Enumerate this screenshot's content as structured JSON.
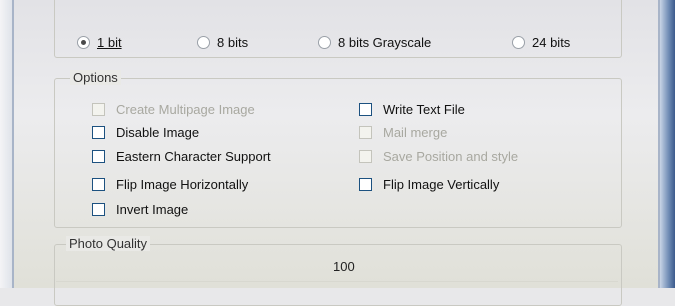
{
  "format": {
    "options": [
      {
        "label": "1 bit",
        "checked": true
      },
      {
        "label": "8 bits",
        "checked": false
      },
      {
        "label": "8 bits Grayscale",
        "checked": false
      },
      {
        "label": "24 bits",
        "checked": false
      }
    ]
  },
  "options": {
    "title": "Options",
    "items": [
      {
        "label": "Create Multipage Image",
        "enabled": false,
        "checked": false
      },
      {
        "label": "Disable Image",
        "enabled": true,
        "checked": false
      },
      {
        "label": "Eastern Character Support",
        "enabled": true,
        "checked": false
      },
      {
        "label": "Flip Image Horizontally",
        "enabled": true,
        "checked": false
      },
      {
        "label": "Invert Image",
        "enabled": true,
        "checked": false
      },
      {
        "label": "Write Text File",
        "enabled": true,
        "checked": false
      },
      {
        "label": "Mail merge",
        "enabled": false,
        "checked": false
      },
      {
        "label": "Save Position and style",
        "enabled": false,
        "checked": false
      },
      {
        "label": "Flip Image Vertically",
        "enabled": true,
        "checked": false
      }
    ]
  },
  "photo_quality": {
    "title": "Photo Quality",
    "value": "100"
  }
}
